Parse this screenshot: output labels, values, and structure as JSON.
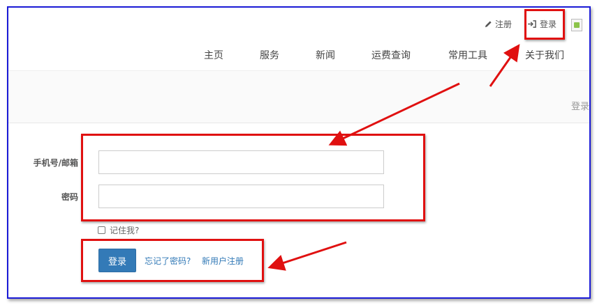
{
  "header": {
    "register_label": "注册",
    "login_label": "登录"
  },
  "nav": {
    "items": [
      {
        "label": "主页"
      },
      {
        "label": "服务"
      },
      {
        "label": "新闻"
      },
      {
        "label": "运费查询"
      },
      {
        "label": "常用工具"
      },
      {
        "label": "关于我们"
      }
    ]
  },
  "banner": {
    "breadcrumb": "登录"
  },
  "form": {
    "account_label": "手机号/邮箱",
    "account_value": "",
    "password_label": "密码",
    "password_value": "",
    "remember_label": "记住我?",
    "submit_label": "登录",
    "forgot_link": "忘记了密码?",
    "register_link": "新用户注册"
  },
  "colors": {
    "primary": "#337ab7",
    "annotation": "#e01010",
    "frame": "#1a1ad6"
  }
}
